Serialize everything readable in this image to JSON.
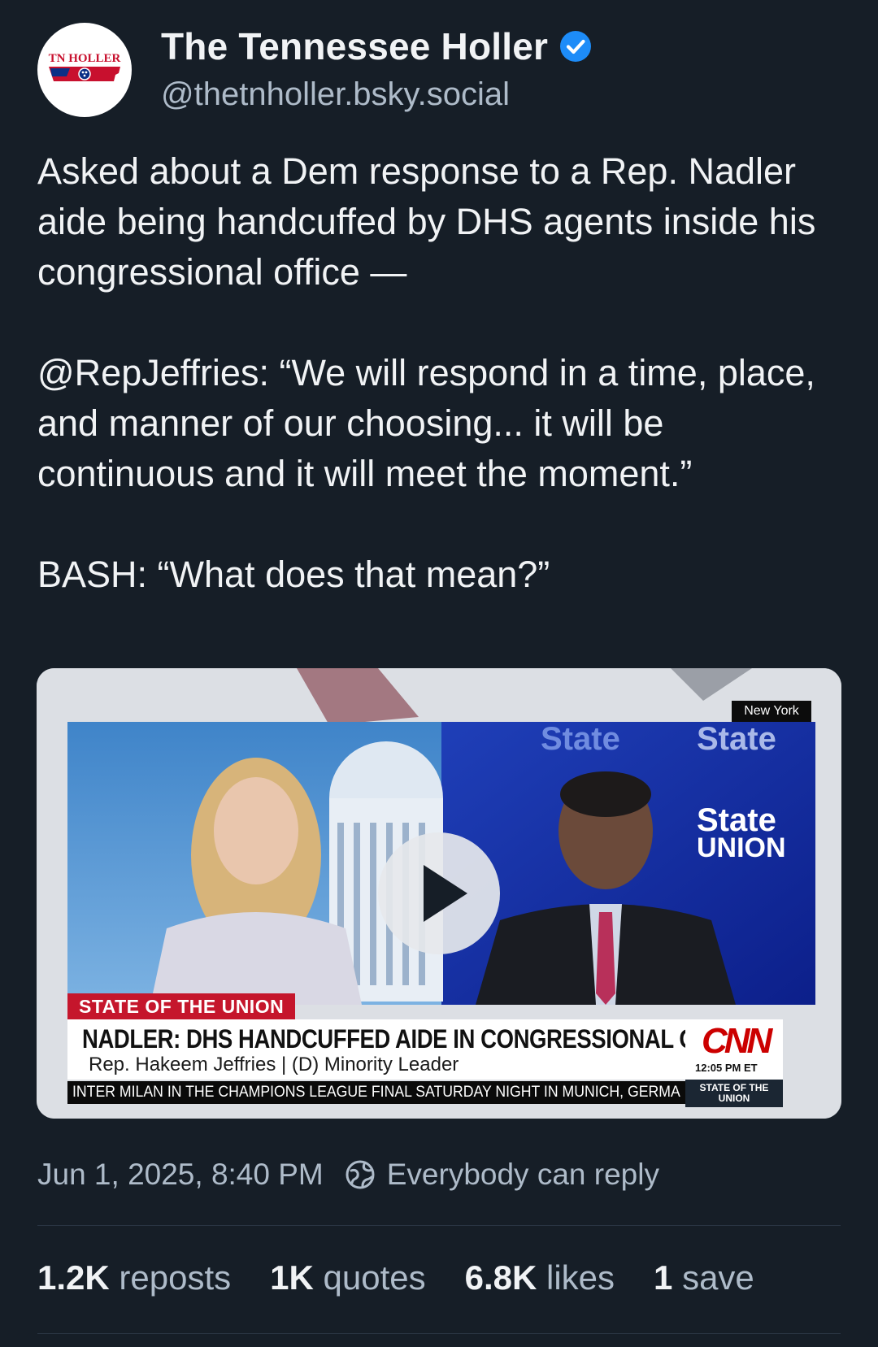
{
  "author": {
    "display_name": "The Tennessee Holler",
    "handle": "@thetnholler.bsky.social",
    "avatar_text": "TN HOLLER",
    "verified": true
  },
  "post": {
    "text": "Asked about a Dem response to a Rep. Nadler aide being handcuffed by DHS agents inside his congressional office —\n\n@RepJeffries: “We will respond in a time, place, and manner of our choosing... it will be continuous and it will meet the moment.”\n\nBASH: “What does that mean?”"
  },
  "video": {
    "location_tag": "New York",
    "show_tag": "STATE OF THE UNION",
    "headline": "NADLER: DHS HANDCUFFED AIDE IN CONGRESSIONAL OFFICE",
    "subline": "Rep. Hakeem Jeffries  |  (D) Minority Leader",
    "network": "CNN",
    "time": "12:05 PM ET",
    "ticker": "INTER MILAN IN THE CHAMPIONS LEAGUE FINAL SATURDAY NIGHT IN MUNICH, GERMA",
    "ticker_logo": "STATE OF THE UNION",
    "bg_text": "State of the UNION"
  },
  "meta": {
    "timestamp": "Jun 1, 2025, 8:40 PM",
    "reply_setting": "Everybody can reply"
  },
  "stats": [
    {
      "count": "1.2K",
      "label": "reposts"
    },
    {
      "count": "1K",
      "label": "quotes"
    },
    {
      "count": "6.8K",
      "label": "likes"
    },
    {
      "count": "1",
      "label": "save"
    }
  ],
  "colors": {
    "background": "#161e27",
    "text_primary": "#f1f3f5",
    "text_secondary": "#aebbc9",
    "verified": "#1d8cf8",
    "cnn_red": "#cc0000"
  }
}
